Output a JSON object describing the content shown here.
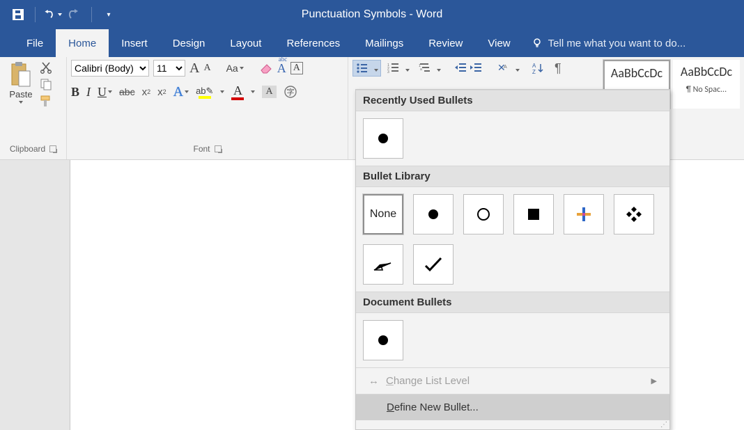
{
  "title": "Punctuation Symbols - Word",
  "qat": {
    "save": "save",
    "undo": "undo",
    "redo": "redo",
    "customize": "customize"
  },
  "tabs": {
    "file": "File",
    "home": "Home",
    "insert": "Insert",
    "design": "Design",
    "layout": "Layout",
    "references": "References",
    "mailings": "Mailings",
    "review": "Review",
    "view": "View",
    "tellme": "Tell me what you want to do..."
  },
  "clipboard": {
    "paste": "Paste",
    "group_label": "Clipboard"
  },
  "font": {
    "name": "Calibri (Body)",
    "size": "11",
    "grow": "A",
    "shrink": "A",
    "case": "Aa",
    "clear": "A",
    "bold": "B",
    "italic": "I",
    "underline": "U",
    "strike": "abc",
    "sub": "x",
    "sup": "x",
    "effects": "A",
    "highlight_color": "#ffff00",
    "font_color": "#d40000",
    "char_shade": "A",
    "group_label": "Font"
  },
  "paragraph": {
    "bullets_active": true,
    "show_marks": "¶"
  },
  "styles": {
    "normal_sample": "AaBbCcDc",
    "normal_label": "",
    "nospacing_sample": "AaBbCcDc",
    "nospacing_label": "¶ No Spac..."
  },
  "bullet_dropdown": {
    "recent_header": "Recently Used Bullets",
    "library_header": "Bullet Library",
    "document_header": "Document Bullets",
    "none_label": "None",
    "change_level": "Change List Level",
    "define_new": "Define New Bullet...",
    "bullets_recent": [
      "disc"
    ],
    "bullets_library": [
      "none",
      "disc",
      "circle",
      "square",
      "clover",
      "diamond4",
      "arrow",
      "check"
    ],
    "bullets_document": [
      "disc"
    ]
  }
}
